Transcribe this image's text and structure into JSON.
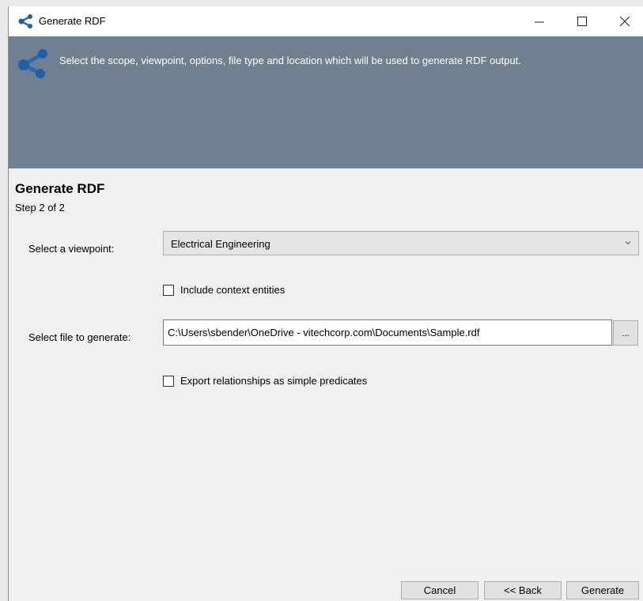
{
  "window": {
    "title": "Generate RDF",
    "icon": "rdf-graph-icon",
    "controls": {
      "minimize": "—",
      "maximize": "□",
      "close": "✕"
    }
  },
  "banner": {
    "text": "Select the scope, viewpoint, options, file type and location which will be used to generate RDF output.",
    "background_color": "#708090"
  },
  "page": {
    "title": "Generate RDF",
    "step": "Step 2 of 2"
  },
  "form": {
    "viewpoint_label": "Select a viewpoint:",
    "viewpoint_value": "Electrical Engineering",
    "include_context_label": "Include context entities",
    "include_context_checked": false,
    "file_label": "Select file to generate:",
    "file_value": "C:\\Users\\sbender\\OneDrive - vitechcorp.com\\Documents\\Sample.rdf",
    "browse_label": "...",
    "export_label": "Export relationships as simple predicates",
    "export_checked": false
  },
  "buttons": {
    "cancel": "Cancel",
    "back": "<< Back",
    "generate": "Generate"
  }
}
